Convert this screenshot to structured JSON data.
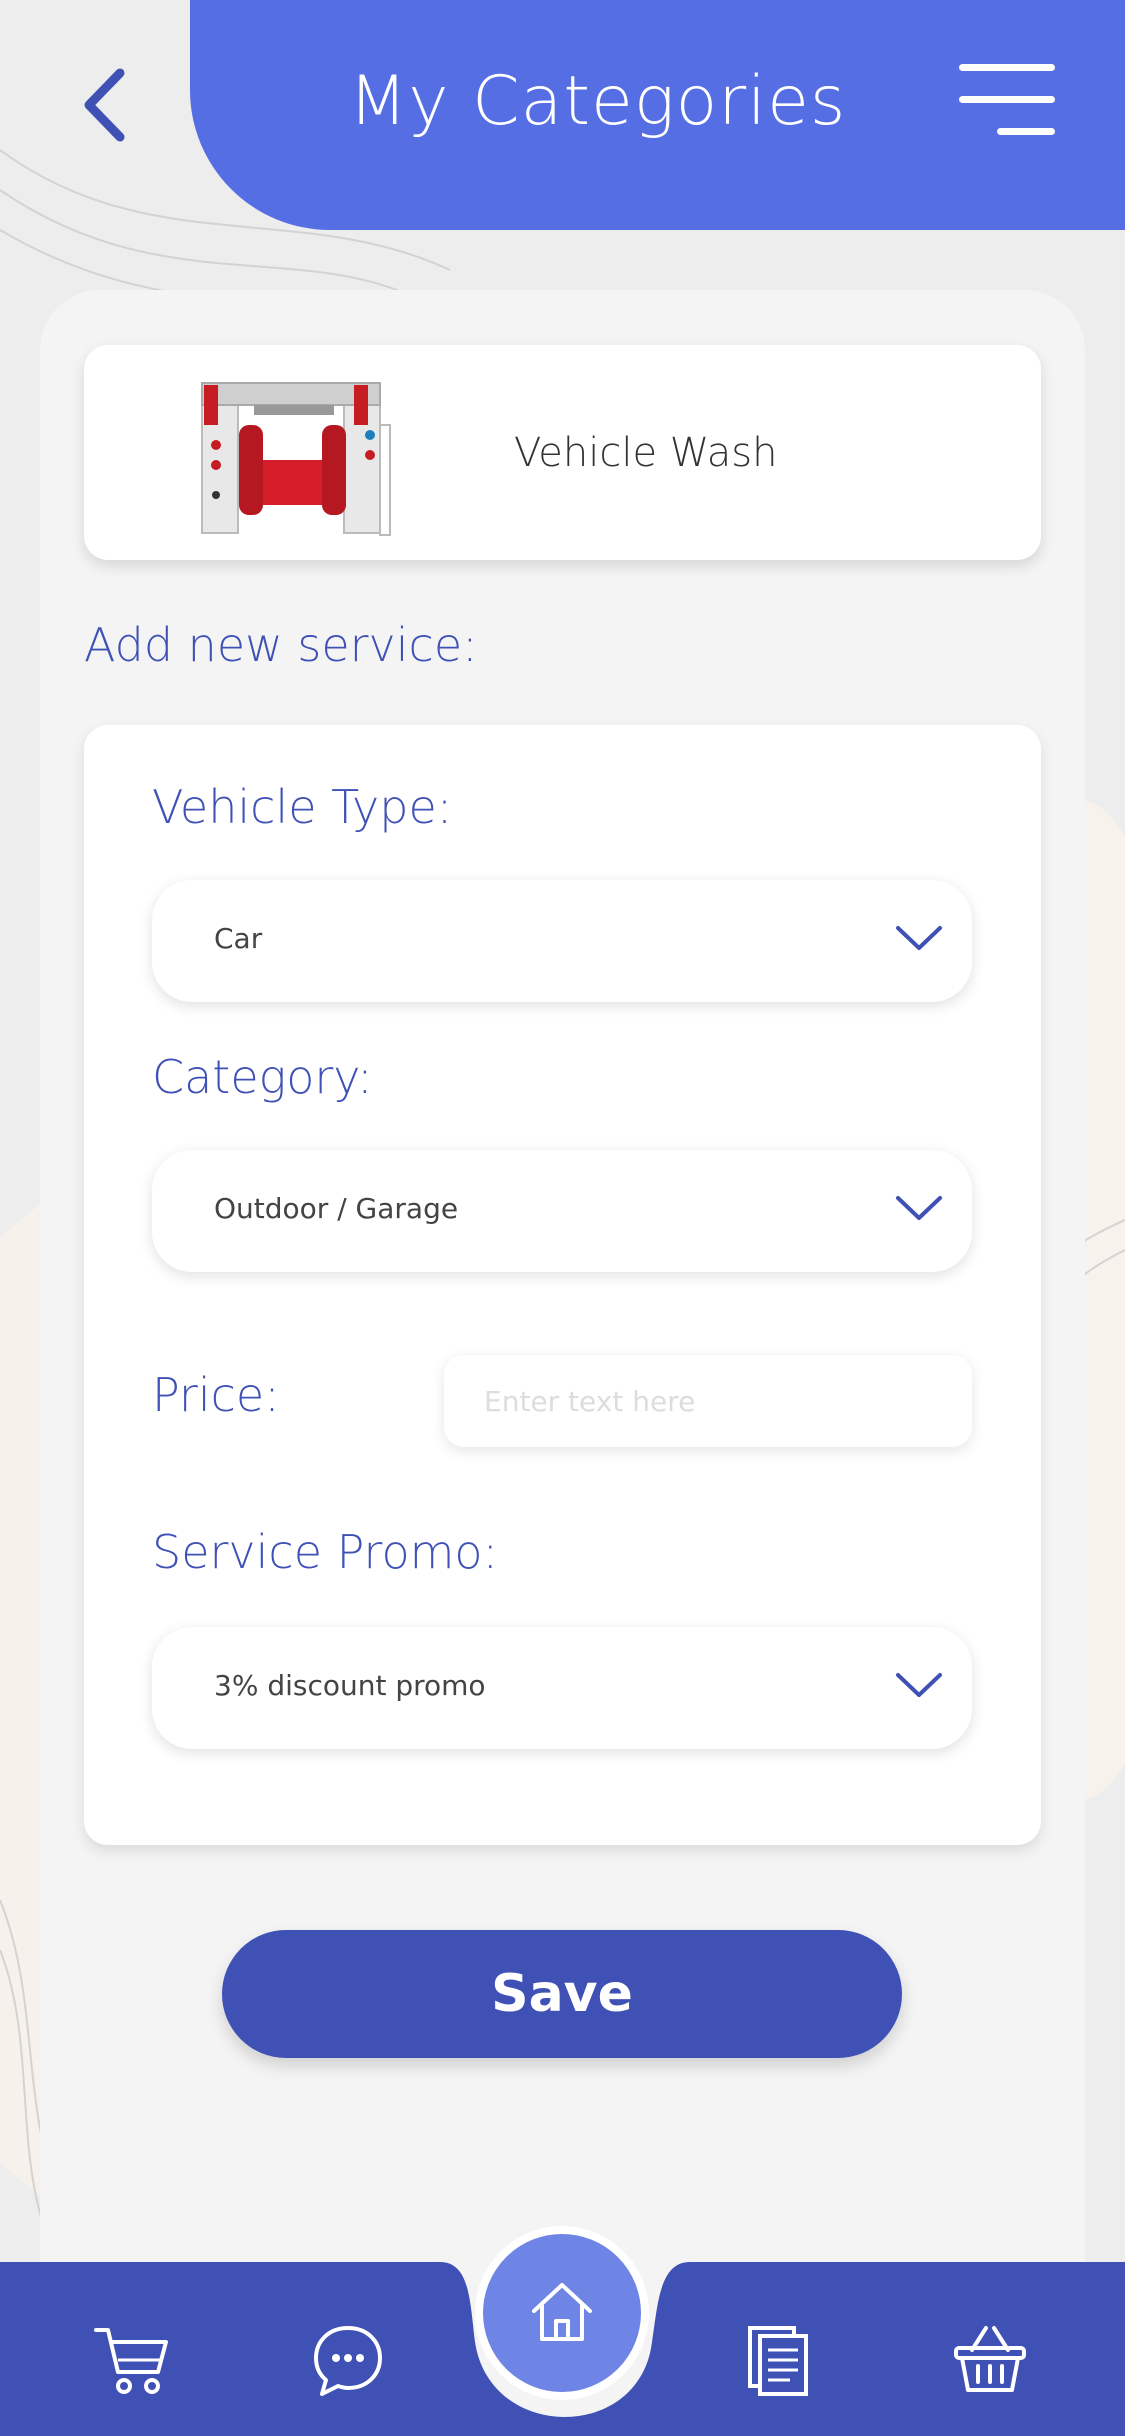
{
  "header": {
    "title": "My Categories"
  },
  "category_card": {
    "name": "Vehicle Wash"
  },
  "form": {
    "section_label": "Add new service:",
    "vehicle_type": {
      "label": "Vehicle Type:",
      "value": "Car"
    },
    "category": {
      "label": "Category:",
      "value": "Outdoor / Garage"
    },
    "price": {
      "label": "Price:",
      "placeholder": "Enter text here"
    },
    "service_promo": {
      "label": "Service Promo:",
      "value": "3% discount promo"
    }
  },
  "save_label": "Save",
  "colors": {
    "accent": "#566ee3",
    "primary": "#3f51b5",
    "home": "#6f85e6"
  },
  "bottom_nav": [
    "cart-icon",
    "chat-icon",
    "home-icon",
    "document-icon",
    "basket-icon"
  ]
}
